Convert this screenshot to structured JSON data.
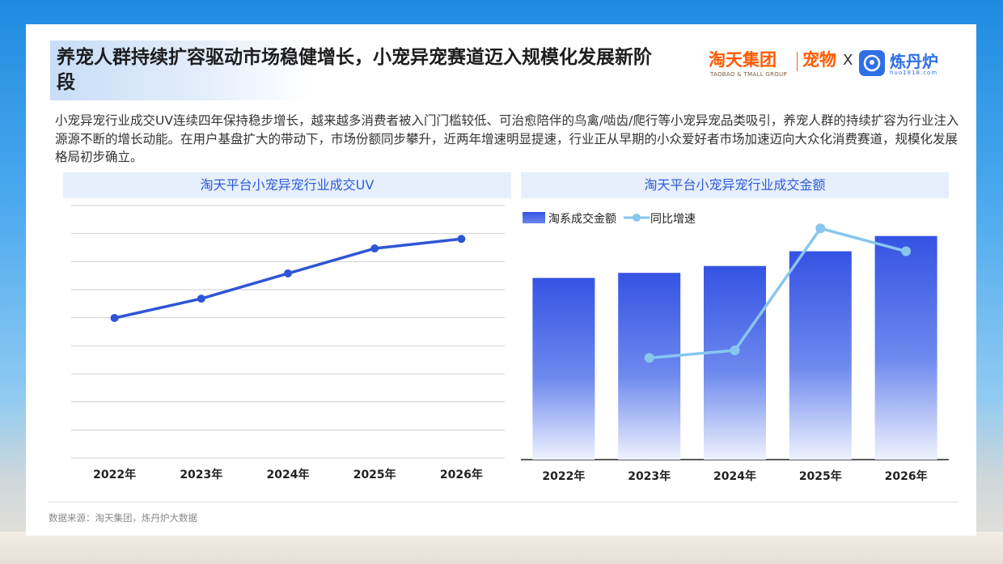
{
  "title": "养宠人群持续扩容驱动市场稳健增长，小宠异宠赛道迈入规模化发展新阶段",
  "brand": {
    "taotian": "淘天集团",
    "taotian_sub": "TAOBAO & TMALL GROUP",
    "pet": "宠物",
    "x": "X",
    "liandanlu": "炼丹炉",
    "url": "huo1818.com"
  },
  "description": "小宠异宠行业成交UV连续四年保持稳步增长，越来越多消费者被入门门槛较低、可治愈陪伴的鸟禽/啮齿/爬行等小宠异宠品类吸引，养宠人群的持续扩容为行业注入源源不断的增长动能。在用户基盘扩大的带动下，市场份额同步攀升，近两年增速明显提速，行业正从早期的小众爱好者市场加速迈向大众化消费赛道，规模化发展格局初步确立。",
  "source": "数据来源：淘天集团，炼丹炉大数据",
  "colors": {
    "accent": "#2f5bd8",
    "line_uv": "#2f55d6",
    "bar": "#3553e3",
    "line_growth": "#88c6ee",
    "orange": "#ff5a00"
  },
  "chart_data": [
    {
      "type": "line",
      "title": "淘天平台小宠异宠行业成交UV",
      "categories": [
        "2022年",
        "2023年",
        "2024年",
        "2025年",
        "2026年"
      ],
      "series": [
        {
          "values": [
            4.99,
            5.68,
            6.58,
            7.47,
            7.81
          ]
        }
      ],
      "ylim": [
        0,
        9
      ],
      "yticks_shown": false,
      "grid": true
    },
    {
      "type": "bar",
      "title": "淘天平台小宠异宠行业成交金额",
      "categories": [
        "2022年",
        "2023年",
        "2024年",
        "2025年",
        "2026年"
      ],
      "series": [
        {
          "name": "淘系成交金额",
          "type": "bar",
          "values": [
            7.15,
            7.35,
            7.62,
            8.2,
            8.8
          ]
        },
        {
          "name": "同比增速",
          "type": "line",
          "values": [
            null,
            4.0,
            4.3,
            9.1,
            8.2
          ]
        }
      ],
      "ylim_bar": [
        0,
        10
      ],
      "ylim_line": [
        0,
        10
      ],
      "legend": "top-left",
      "grid": false
    }
  ]
}
